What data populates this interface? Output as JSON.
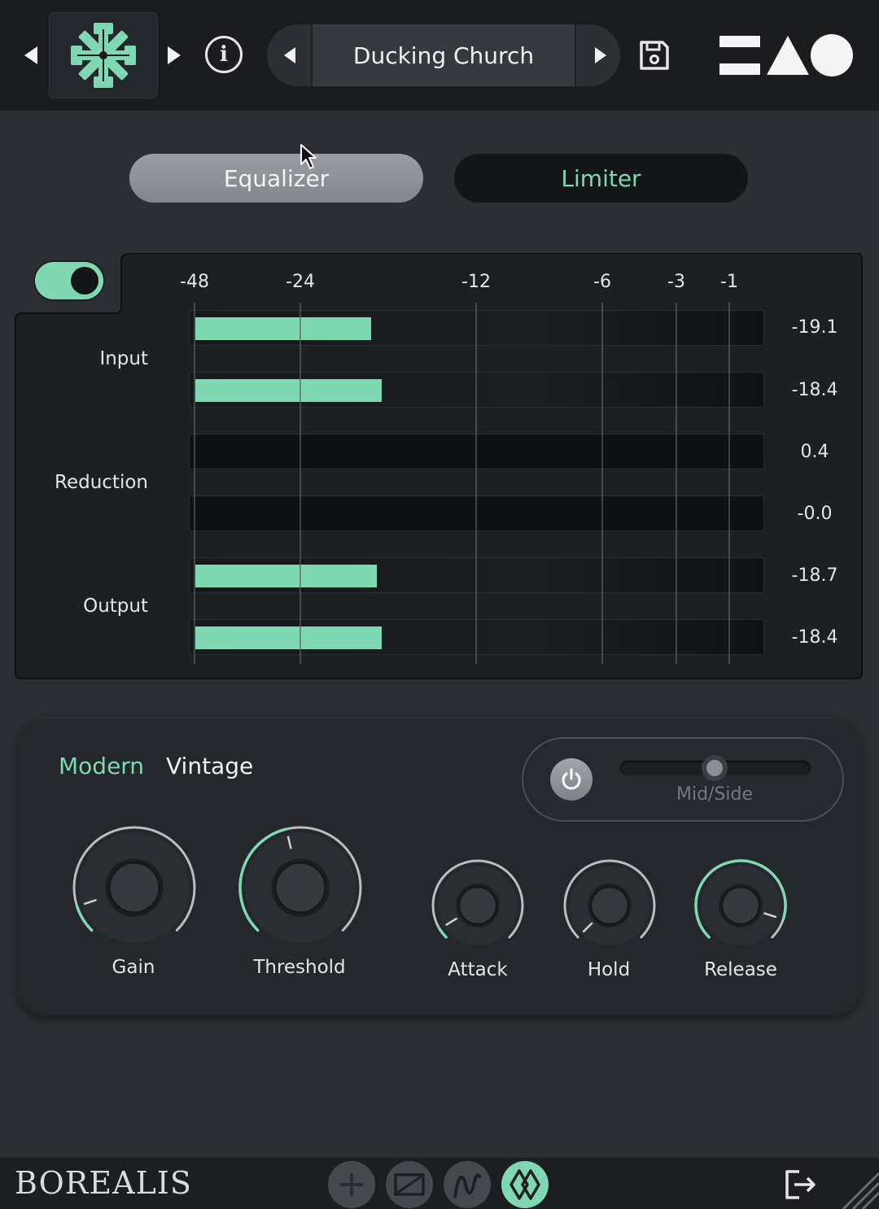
{
  "header": {
    "preset_name": "Ducking Church",
    "icons": [
      "prev-icon",
      "snowflake-logo-icon",
      "next-icon",
      "info-icon",
      "preset-prev-icon",
      "preset-next-icon",
      "save-icon",
      "brand-shapes-icon"
    ]
  },
  "tabs": [
    {
      "label": "Equalizer",
      "active": true
    },
    {
      "label": "Limiter",
      "active": false
    }
  ],
  "meter": {
    "enabled": true,
    "scale": [
      "-48",
      "-24",
      "-12",
      "-6",
      "-3",
      "-1"
    ],
    "groups": [
      {
        "label": "Input",
        "rows": [
          {
            "value": "-19.1",
            "level": -19.1
          },
          {
            "value": "-18.4",
            "level": -18.4
          }
        ]
      },
      {
        "label": "Reduction",
        "rows": [
          {
            "value": "0.4",
            "level": 0.4
          },
          {
            "value": "-0.0",
            "level": 0.0
          }
        ]
      },
      {
        "label": "Output",
        "rows": [
          {
            "value": "-18.7",
            "level": -18.7
          },
          {
            "value": "-18.4",
            "level": -18.4
          }
        ]
      }
    ]
  },
  "controls": {
    "modes": [
      {
        "label": "Modern",
        "active": true
      },
      {
        "label": "Vintage",
        "active": false
      }
    ],
    "mid_side": {
      "label": "Mid/Side",
      "power": "off",
      "value": 0.5
    },
    "knobs": [
      {
        "label": "Gain",
        "value": 0.1
      },
      {
        "label": "Threshold",
        "value": 0.45
      },
      {
        "label": "Attack",
        "value": 0.05
      },
      {
        "label": "Hold",
        "value": 0.0
      },
      {
        "label": "Release",
        "value": 0.9
      }
    ]
  },
  "footer": {
    "brand": "BOREALIS",
    "buttons": [
      "plus-icon",
      "envelope-icon",
      "wave-icon",
      "diamond-pattern-icon"
    ],
    "active_button": "diamond-pattern-icon"
  },
  "colors": {
    "accent": "#7fd8b2",
    "background": "#2b2e33",
    "topbar": "#1a1c1f",
    "panel": "#24272b"
  }
}
